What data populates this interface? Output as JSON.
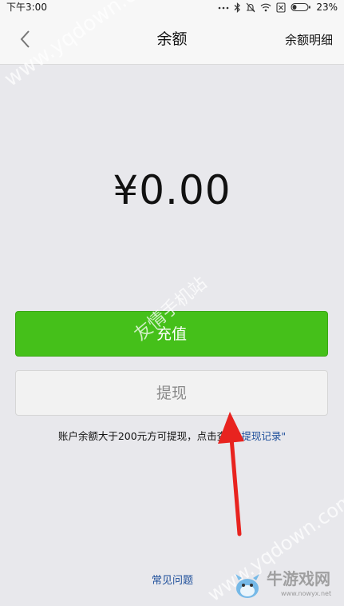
{
  "status_bar": {
    "time": "下午3:00",
    "battery": "23%"
  },
  "nav": {
    "title": "余额",
    "right_label": "余额明细"
  },
  "balance": {
    "amount": "¥0.00"
  },
  "actions": {
    "recharge_label": "充值",
    "withdraw_label": "提现"
  },
  "note": {
    "text": "账户余额大于200元方可提现，点击查看",
    "link": "\"提现记录\""
  },
  "footer": {
    "faq_label": "常见问题"
  },
  "watermarks": {
    "url": "www.yqdown.com",
    "site_name": "友情手机站",
    "logo_cn": "牛游戏网",
    "logo_url": "www.nowyx.net"
  },
  "colors": {
    "primary_green": "#45c01a",
    "link_blue": "#1d4e9a",
    "annotation_arrow": "#e8231f"
  }
}
